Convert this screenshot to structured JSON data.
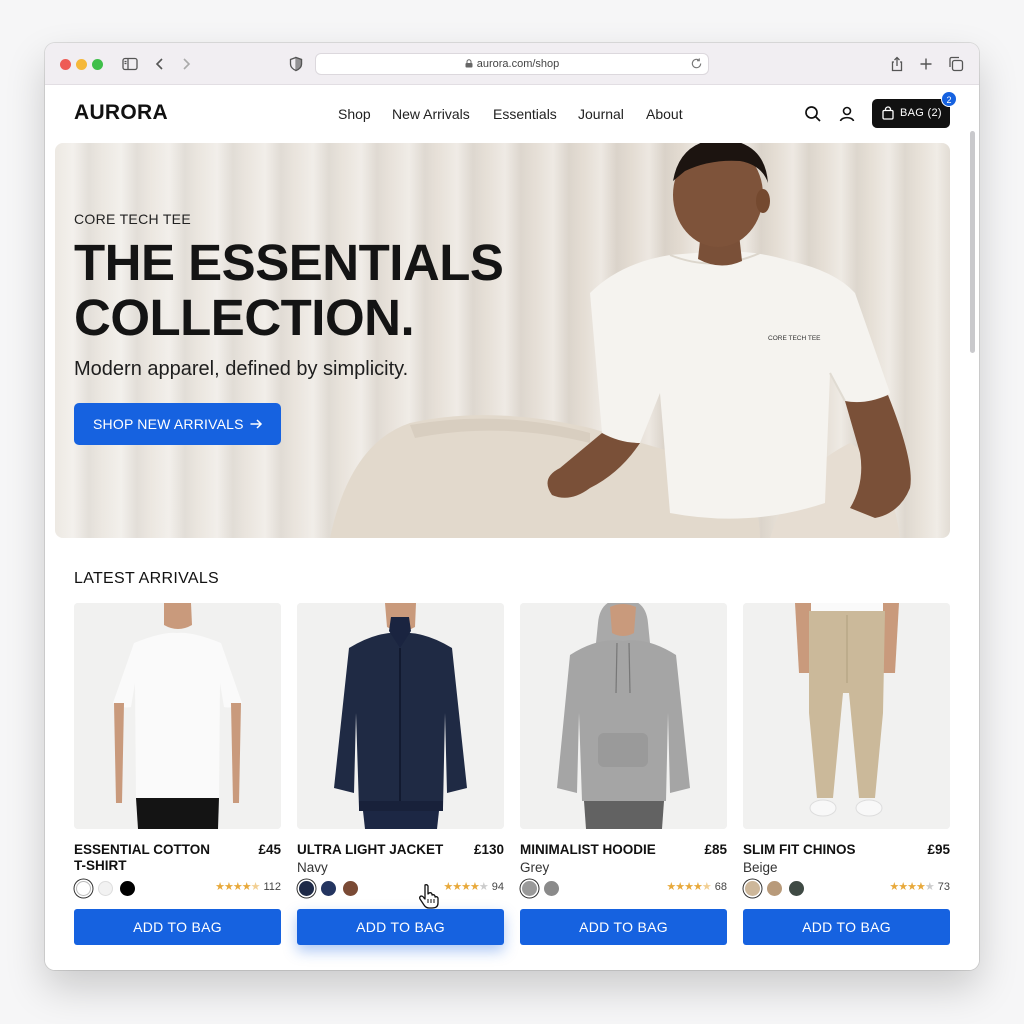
{
  "browser": {
    "url": "aurora.com/shop"
  },
  "header": {
    "logo": "AURORA",
    "nav": [
      "Shop",
      "New Arrivals",
      "Essentials",
      "Journal",
      "About"
    ],
    "bag_label": "BAG (2)",
    "bag_count": "2"
  },
  "hero": {
    "eyebrow": "CORE TECH TEE",
    "title": "THE ESSENTIALS COLLECTION.",
    "subtitle": "Modern apparel, defined by simplicity.",
    "cta": "SHOP NEW ARRIVALS",
    "shirt_print": "CORE TECH TEE"
  },
  "section_title": "LATEST ARRIVALS",
  "products": [
    {
      "name": "ESSENTIAL COTTON T-SHIRT",
      "price": "£45",
      "color_label": "",
      "swatches": [
        "#ffffff",
        "#f2f2f2",
        "#000000"
      ],
      "rating": 4.5,
      "reviews": "112",
      "button": "ADD TO BAG"
    },
    {
      "name": "ULTRA LIGHT JACKET",
      "price": "£130",
      "color_label": "Navy",
      "swatches": [
        "#1e2a48",
        "#243560",
        "#7a4a35"
      ],
      "rating": 4,
      "reviews": "94",
      "button": "ADD TO BAG"
    },
    {
      "name": "MINIMALIST HOODIE",
      "price": "£85",
      "color_label": "Grey",
      "swatches": [
        "#9a9a9a",
        "#8a8a8a"
      ],
      "rating": 4.5,
      "reviews": "68",
      "button": "ADD TO BAG"
    },
    {
      "name": "SLIM FIT CHINOS",
      "price": "£95",
      "color_label": "Beige",
      "swatches": [
        "#cdb79a",
        "#b89a7a",
        "#3f4a44"
      ],
      "rating": 4,
      "reviews": "73",
      "button": "ADD TO BAG"
    }
  ],
  "colors": {
    "accent": "#1662e0",
    "dark": "#111111",
    "star": "#e8a93b"
  }
}
